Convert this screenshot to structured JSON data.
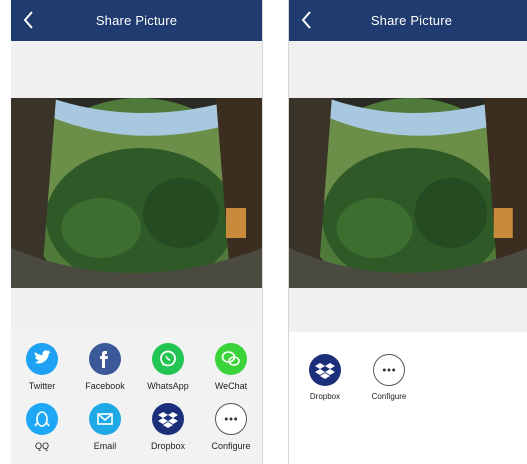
{
  "left_screen": {
    "header": {
      "back_icon": "chevron-left-icon",
      "title": "Share Picture"
    },
    "share_items": [
      {
        "label": "Twitter",
        "icon": "twitter-icon",
        "color": "#1da1f2"
      },
      {
        "label": "Facebook",
        "icon": "facebook-icon",
        "color": "#3b5998"
      },
      {
        "label": "WhatsApp",
        "icon": "whatsapp-icon",
        "color": "#23c552"
      },
      {
        "label": "WeChat",
        "icon": "wechat-icon",
        "color": "#3ad43a"
      },
      {
        "label": "QQ",
        "icon": "qq-icon",
        "color": "#1ea7f5"
      },
      {
        "label": "Email",
        "icon": "email-icon",
        "color": "#1fa8e6"
      },
      {
        "label": "Dropbox",
        "icon": "dropbox-icon",
        "color": "#1c2f7a"
      },
      {
        "label": "Configure",
        "icon": "more-dots-icon",
        "color": "#ffffff"
      }
    ]
  },
  "right_screen": {
    "header": {
      "back_icon": "chevron-left-icon",
      "title": "Share Picture"
    },
    "share_items": [
      {
        "label": "Dropbox",
        "icon": "dropbox-icon",
        "color": "#1c2f7a"
      },
      {
        "label": "Configure",
        "icon": "more-dots-icon",
        "color": "#ffffff"
      }
    ]
  },
  "colors": {
    "header": "#1f3b6f",
    "panel": "#f2f2f2",
    "band": "#f0f0f0"
  }
}
